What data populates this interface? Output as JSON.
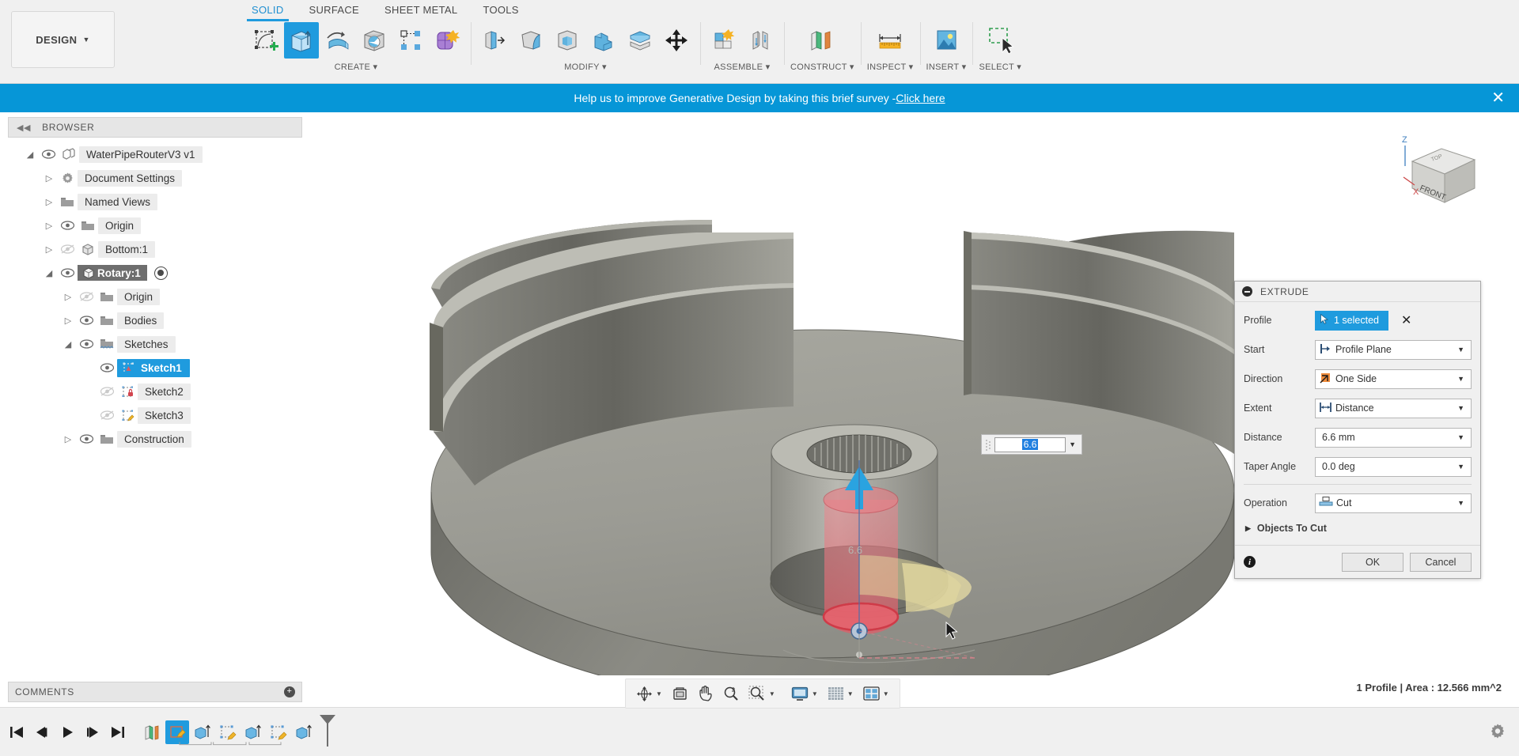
{
  "app": {
    "workspace_label": "DESIGN",
    "tabs": [
      {
        "label": "SOLID",
        "active": true
      },
      {
        "label": "SURFACE",
        "active": false
      },
      {
        "label": "SHEET METAL",
        "active": false
      },
      {
        "label": "TOOLS",
        "active": false
      }
    ],
    "tool_groups": [
      {
        "label": "CREATE",
        "icons": [
          "create-sketch-icon",
          "extrude-icon",
          "revolve-icon",
          "hole-icon",
          "rib-icon",
          "form-icon"
        ]
      },
      {
        "label": "MODIFY",
        "icons": [
          "press-pull-icon",
          "fillet-icon",
          "shell-icon",
          "combine-icon",
          "split-face-icon",
          "move-copy-icon"
        ]
      },
      {
        "label": "ASSEMBLE",
        "icons": [
          "new-component-icon",
          "joint-icon"
        ]
      },
      {
        "label": "CONSTRUCT",
        "icons": [
          "offset-plane-icon"
        ]
      },
      {
        "label": "INSPECT",
        "icons": [
          "measure-icon"
        ]
      },
      {
        "label": "INSERT",
        "icons": [
          "insert-canvas-icon"
        ]
      },
      {
        "label": "SELECT",
        "icons": [
          "select-icon"
        ]
      }
    ]
  },
  "banner": {
    "text": "Help us to improve Generative Design by taking this brief survey - ",
    "link": "Click here",
    "close_icon": "close-icon"
  },
  "browser": {
    "title": "BROWSER",
    "collapse_icon": "collapse-left-icon",
    "tree": [
      {
        "label": "WaterPipeRouterV3 v1",
        "depth": 0,
        "arrow": "expanded",
        "eye": "visible",
        "icon": "component-icon",
        "selected": false
      },
      {
        "label": "Document Settings",
        "depth": 1,
        "arrow": "collapsed",
        "eye": "none",
        "icon": "gear-icon",
        "selected": false
      },
      {
        "label": "Named Views",
        "depth": 1,
        "arrow": "collapsed",
        "eye": "none",
        "icon": "folder-icon",
        "selected": false
      },
      {
        "label": "Origin",
        "depth": 1,
        "arrow": "collapsed",
        "eye": "visible",
        "icon": "folder-icon",
        "selected": false
      },
      {
        "label": "Bottom:1",
        "depth": 1,
        "arrow": "collapsed",
        "eye": "hidden",
        "icon": "body-icon",
        "selected": false
      },
      {
        "label": "Rotary:1",
        "depth": 1,
        "arrow": "expanded",
        "eye": "visible",
        "icon": "body-icon",
        "selected": true,
        "badge": "activated-radio-icon"
      },
      {
        "label": "Origin",
        "depth": 2,
        "arrow": "collapsed",
        "eye": "hidden",
        "icon": "folder-icon",
        "selected": false
      },
      {
        "label": "Bodies",
        "depth": 2,
        "arrow": "collapsed",
        "eye": "visible",
        "icon": "folder-icon",
        "selected": false
      },
      {
        "label": "Sketches",
        "depth": 2,
        "arrow": "expanded",
        "eye": "visible",
        "icon": "folder-icon",
        "selected": false
      },
      {
        "label": "Sketch1",
        "depth": 3,
        "arrow": "none",
        "eye": "visible",
        "icon": "sketch-icon",
        "selected": true
      },
      {
        "label": "Sketch2",
        "depth": 3,
        "arrow": "none",
        "eye": "hidden",
        "icon": "sketch-locked-icon",
        "selected": false
      },
      {
        "label": "Sketch3",
        "depth": 3,
        "arrow": "none",
        "eye": "hidden",
        "icon": "sketch-edit-icon",
        "selected": false
      },
      {
        "label": "Construction",
        "depth": 2,
        "arrow": "collapsed",
        "eye": "visible",
        "icon": "folder-icon",
        "selected": false
      }
    ]
  },
  "extrude_dialog": {
    "title": "EXTRUDE",
    "collapse_icon": "minimize-icon",
    "profile": {
      "label": "Profile",
      "value": "1 selected",
      "icon": "cursor-arrow-icon",
      "clear_icon": "close-icon"
    },
    "fields": [
      {
        "label": "Start",
        "value": "Profile Plane",
        "icon": "start-plane-icon"
      },
      {
        "label": "Direction",
        "value": "One Side",
        "icon": "one-side-icon"
      },
      {
        "label": "Extent",
        "value": "Distance",
        "icon": "distance-icon"
      },
      {
        "label": "Distance",
        "value": "6.6 mm",
        "icon": ""
      },
      {
        "label": "Taper Angle",
        "value": "0.0 deg",
        "icon": ""
      }
    ],
    "operation": {
      "label": "Operation",
      "value": "Cut",
      "icon": "cut-icon"
    },
    "objects_to_cut": {
      "label": "Objects To Cut",
      "icon": "triangle-right-icon"
    },
    "footer": {
      "info_icon": "info-icon",
      "ok_label": "OK",
      "cancel_label": "Cancel"
    }
  },
  "dimension_input": {
    "value": "6.6",
    "dropdown_icon": "chevron-down-icon"
  },
  "viewcube": {
    "front_label": "FRONT",
    "top_label": "TOP",
    "z_label": "Z",
    "x_label": "X"
  },
  "comments": {
    "title": "COMMENTS",
    "add_icon": "add-comment-icon"
  },
  "navbar": {
    "items": [
      {
        "icon": "orbit-icon",
        "dropdown": true
      },
      {
        "icon": "look-at-icon",
        "dropdown": false
      },
      {
        "icon": "pan-icon",
        "dropdown": false
      },
      {
        "icon": "zoom-icon",
        "dropdown": false
      },
      {
        "icon": "zoom-window-icon",
        "dropdown": true
      },
      {
        "icon": "display-settings-icon",
        "dropdown": true
      },
      {
        "icon": "grid-snap-icon",
        "dropdown": true
      },
      {
        "icon": "viewports-icon",
        "dropdown": true
      }
    ]
  },
  "status_bar": {
    "text": "1 Profile | Area : 12.566 mm^2"
  },
  "timeline": {
    "controls": [
      {
        "icon": "go-to-beginning-icon"
      },
      {
        "icon": "step-back-icon"
      },
      {
        "icon": "play-icon"
      },
      {
        "icon": "step-forward-icon"
      },
      {
        "icon": "go-to-end-icon"
      }
    ],
    "features": [
      {
        "icon": "construct-plane-icon",
        "selected": false
      },
      {
        "icon": "sketch-icon",
        "selected": true
      },
      {
        "icon": "extrude-icon",
        "selected": false
      },
      {
        "icon": "sketch-icon",
        "selected": false
      },
      {
        "icon": "extrude-icon",
        "selected": false
      },
      {
        "icon": "sketch-icon",
        "selected": false
      },
      {
        "icon": "extrude-icon",
        "selected": false
      }
    ],
    "end_marker_icon": "timeline-marker-icon",
    "settings_icon": "gear-icon"
  },
  "colors": {
    "accent": "#1f9bde",
    "banner": "#0696d7",
    "panel": "#f0f0f0",
    "model_gray": "#8e8e88",
    "highlight_red": "#e0636b",
    "highlight_yellow": "#e6d89a"
  }
}
